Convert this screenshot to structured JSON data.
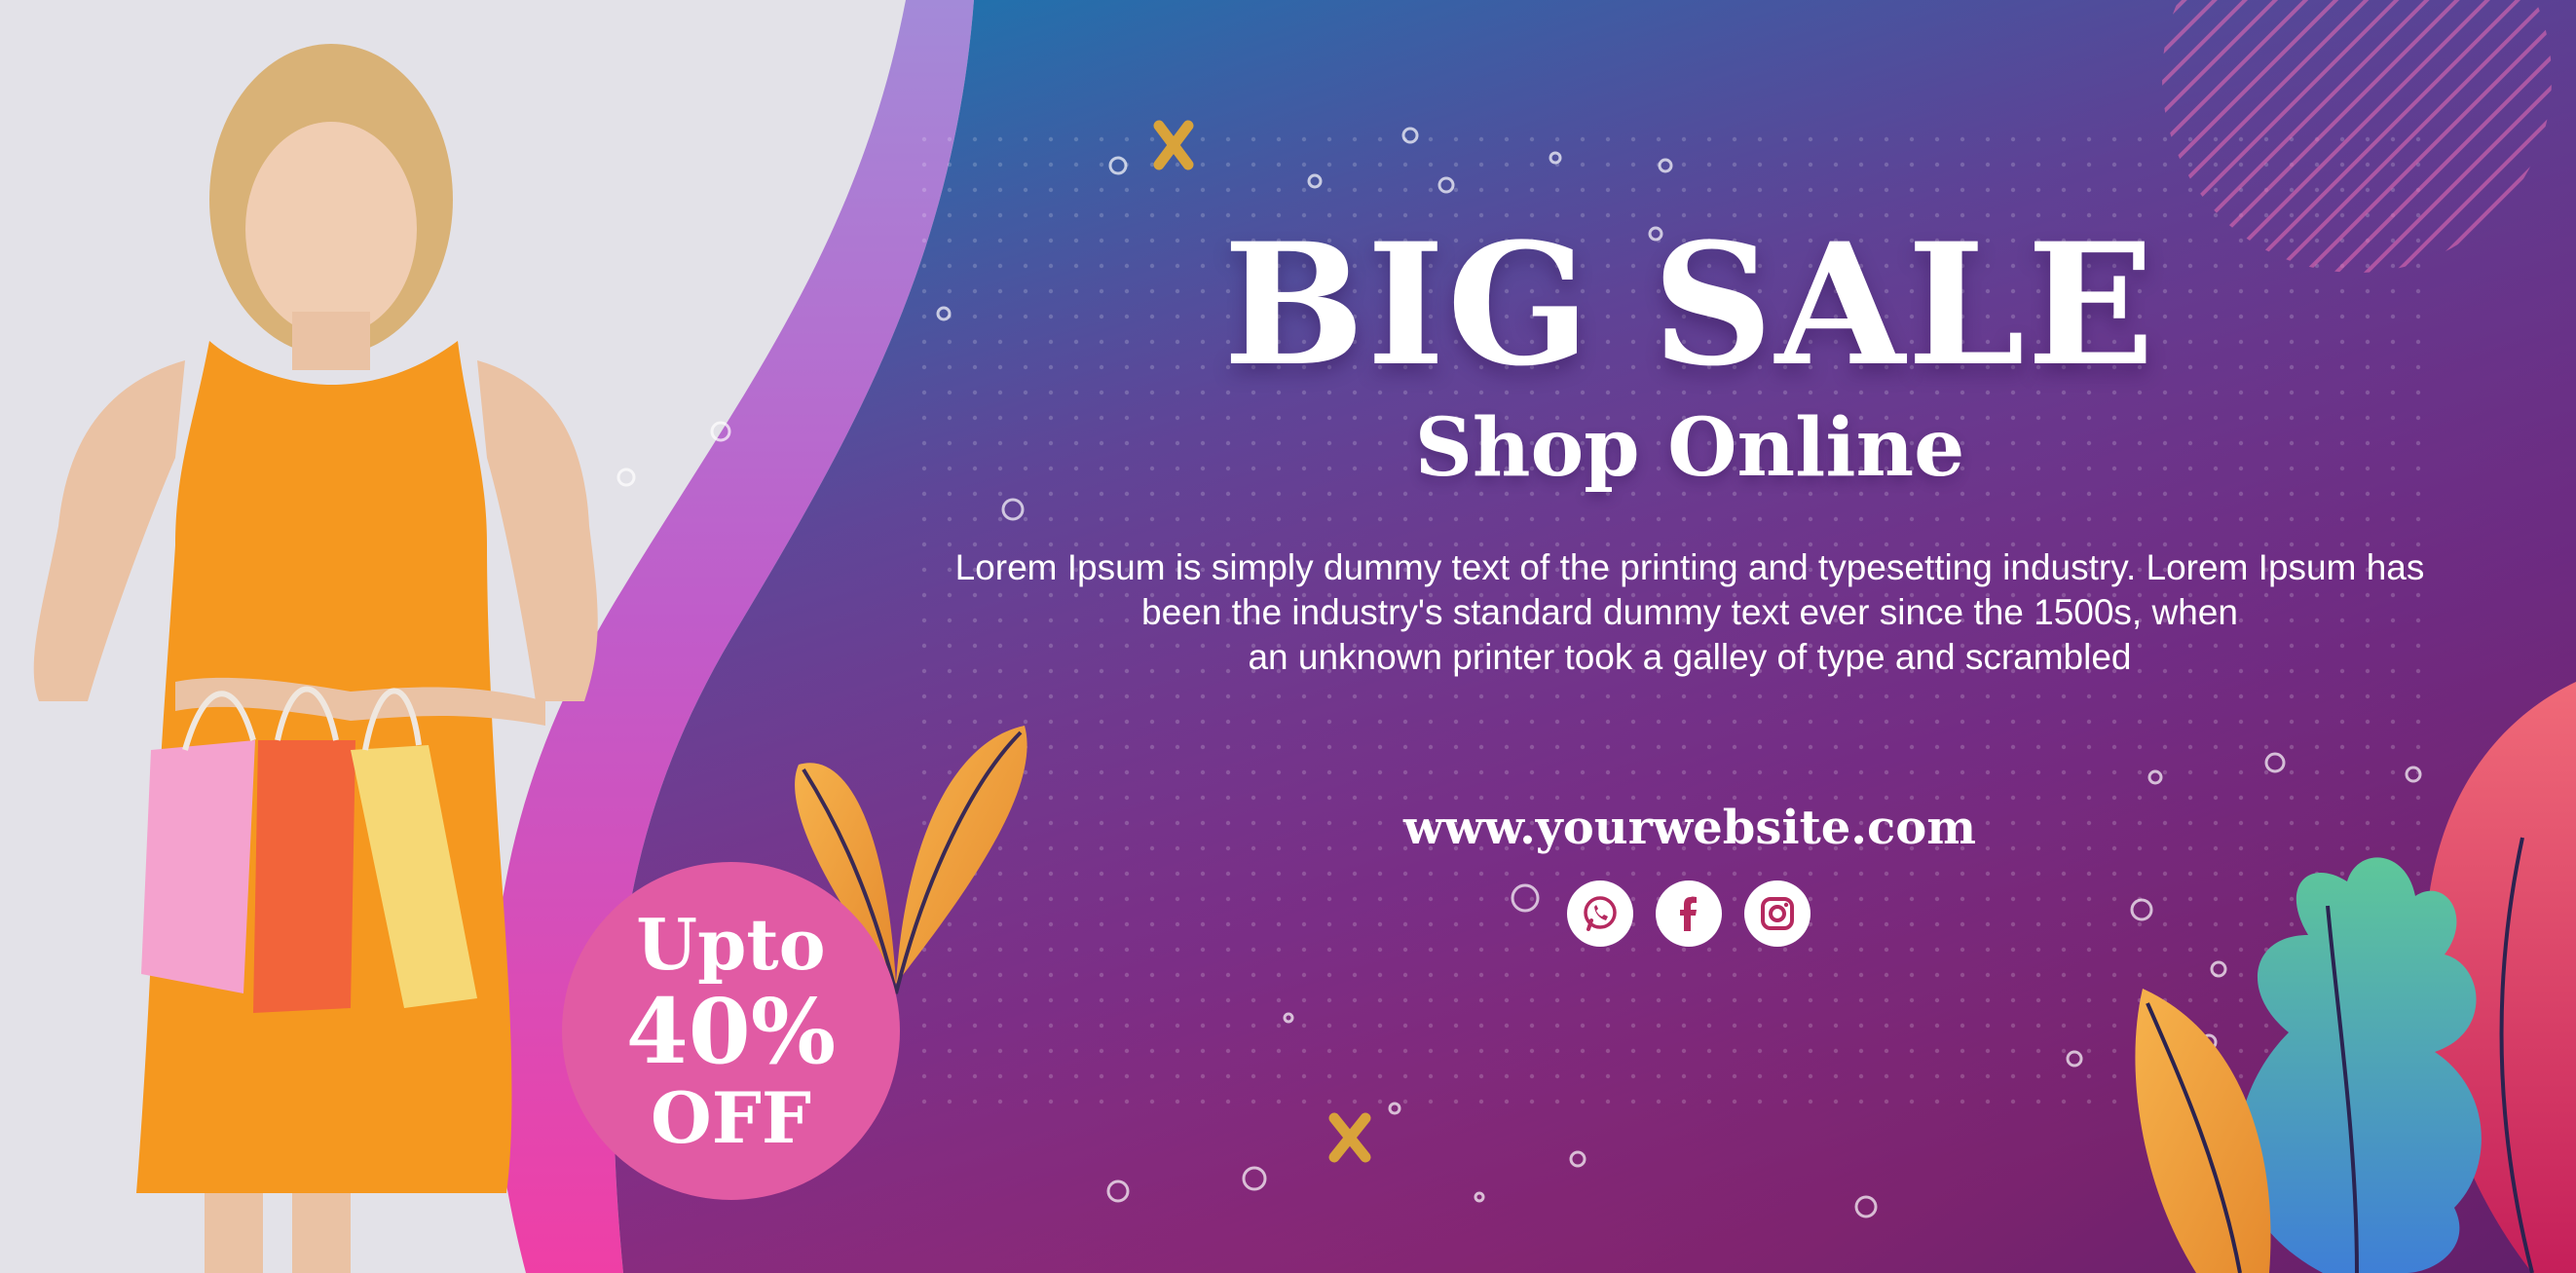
{
  "banner": {
    "headline": "BIG SALE",
    "subheadline": "Shop Online",
    "body_lines": [
      "Lorem Ipsum is simply dummy text of the printing and typesetting industry. Lorem Ipsum has",
      "been the industry's standard dummy text ever since the 1500s, when",
      "an unknown printer took a galley of type and scrambled"
    ],
    "website": "www.yourwebsite.com",
    "badge": {
      "line1": "Upto",
      "line2": "40%",
      "line3": "OFF"
    },
    "social_icons": [
      "whatsapp-icon",
      "facebook-icon",
      "instagram-icon"
    ]
  },
  "colors": {
    "gradient_top": "#1d78b0",
    "gradient_mid": "#6a3e9a",
    "gradient_bottom": "#d2235f",
    "badge": "#e15ba4",
    "dress": "#f5981f"
  }
}
